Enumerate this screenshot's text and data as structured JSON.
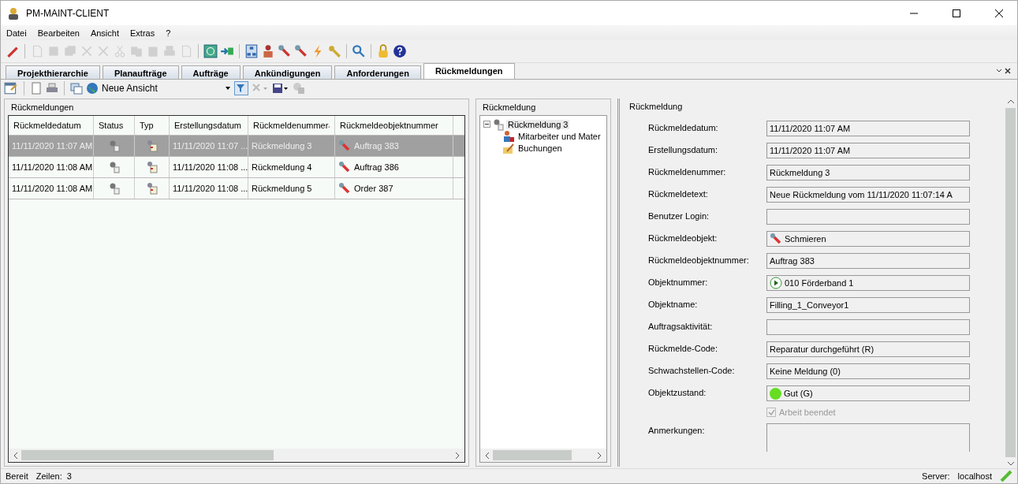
{
  "window": {
    "title": "PM-MAINT-CLIENT"
  },
  "menu": [
    "Datei",
    "Bearbeiten",
    "Ansicht",
    "Extras",
    "?"
  ],
  "toolbar": [
    {
      "kind": "pen",
      "disabled": false
    },
    {
      "kind": "sep"
    },
    {
      "kind": "page",
      "disabled": true
    },
    {
      "kind": "save",
      "disabled": true
    },
    {
      "kind": "saveall",
      "disabled": true
    },
    {
      "kind": "cross",
      "disabled": true
    },
    {
      "kind": "cross",
      "disabled": true
    },
    {
      "kind": "cut",
      "disabled": true
    },
    {
      "kind": "copy",
      "disabled": true
    },
    {
      "kind": "paste",
      "disabled": true
    },
    {
      "kind": "print",
      "disabled": true
    },
    {
      "kind": "page",
      "disabled": true
    },
    {
      "kind": "sep"
    },
    {
      "kind": "refresh",
      "disabled": false
    },
    {
      "kind": "export",
      "disabled": false
    },
    {
      "kind": "sep"
    },
    {
      "kind": "tree",
      "disabled": false
    },
    {
      "kind": "people",
      "disabled": false
    },
    {
      "kind": "wrench",
      "disabled": false
    },
    {
      "kind": "wrench",
      "disabled": false
    },
    {
      "kind": "bolt",
      "disabled": false
    },
    {
      "kind": "key",
      "disabled": false
    },
    {
      "kind": "sep"
    },
    {
      "kind": "search",
      "disabled": false
    },
    {
      "kind": "sep"
    },
    {
      "kind": "lock",
      "disabled": false
    },
    {
      "kind": "help",
      "disabled": false
    }
  ],
  "tabs": [
    {
      "label": "Projekthierarchie",
      "selected": false
    },
    {
      "label": "Planaufträge",
      "selected": false
    },
    {
      "label": "Aufträge",
      "selected": false
    },
    {
      "label": "Ankündigungen",
      "selected": false
    },
    {
      "label": "Anforderungen",
      "selected": false
    },
    {
      "label": "Rückmeldungen",
      "selected": true
    }
  ],
  "view": {
    "label": "Neue Ansicht"
  },
  "list_panel": {
    "title": "Rückmeldungen",
    "columns": [
      {
        "label": "Rückmeldedatum",
        "sorted": false
      },
      {
        "label": "Status",
        "sorted": false
      },
      {
        "label": "Typ",
        "sorted": false
      },
      {
        "label": "Erstellungsdatum",
        "sorted": false
      },
      {
        "label": "Rückmeldenummer",
        "sorted": true
      },
      {
        "label": "Rückmeldeobjektnummer",
        "sorted": false
      }
    ],
    "rows": [
      {
        "selected": true,
        "date": "11/11/2020 11:07 AM",
        "created": "11/11/2020 11:07 ...",
        "number": "Rückmeldung 3",
        "object": "Auftrag 383"
      },
      {
        "selected": false,
        "date": "11/11/2020 11:08 AM",
        "created": "11/11/2020 11:08 ...",
        "number": "Rückmeldung 4",
        "object": "Auftrag 386"
      },
      {
        "selected": false,
        "date": "11/11/2020 11:08 AM",
        "created": "11/11/2020 11:08 ...",
        "number": "Rückmeldung 5",
        "object": "Order 387"
      }
    ]
  },
  "tree_panel": {
    "title": "Rückmeldung",
    "root": {
      "label": "Rückmeldung 3",
      "expanded": true,
      "selected": true,
      "children": [
        {
          "label": "Mitarbeiter und Mater",
          "kind": "people",
          "selected": false
        },
        {
          "label": "Buchungen",
          "kind": "booking",
          "selected": false
        }
      ]
    }
  },
  "detail_panel": {
    "title": "Rückmeldung",
    "fields": [
      {
        "label": "Rückmeldedatum:",
        "value": "11/11/2020 11:07 AM"
      },
      {
        "label": "Erstellungsdatum:",
        "value": "11/11/2020 11:07 AM"
      },
      {
        "label": "Rückmeldenummer:",
        "value": "Rückmeldung 3"
      },
      {
        "label": "Rückmeldetext:",
        "value": "Neue Rückmeldung vom 11/11/2020 11:07:14 A"
      },
      {
        "label": "Benutzer Login:"
      },
      {
        "label": "Rückmeldeobjekt:",
        "value": "Schmieren",
        "kind": "wrench"
      },
      {
        "label": "Rückmeldeobjektnummer:",
        "value": "Auftrag 383"
      },
      {
        "label": "Objektnummer:",
        "value": "010 Förderband 1",
        "kind": "play"
      },
      {
        "label": "Objektname:",
        "value": "Filling_1_Conveyor1"
      },
      {
        "label": "Auftragsaktivität:"
      },
      {
        "label": "Rückmelde-Code:",
        "value": "Reparatur durchgeführt (R)"
      },
      {
        "label": "Schwachstellen-Code:",
        "value": "Keine Meldung (0)"
      },
      {
        "label": "Objektzustand:",
        "value": "Gut (G)",
        "kind": "dot",
        "color": "#66dd22"
      }
    ],
    "checkbox": {
      "label": "Arbeit beendet",
      "checked": true,
      "disabled": true
    },
    "notes": {
      "label": "Anmerkungen:"
    }
  },
  "status_bar": {
    "state": "Bereit",
    "rows_label": "Zeilen:",
    "rows": "3",
    "server_label": "Server:",
    "server": "localhost"
  }
}
